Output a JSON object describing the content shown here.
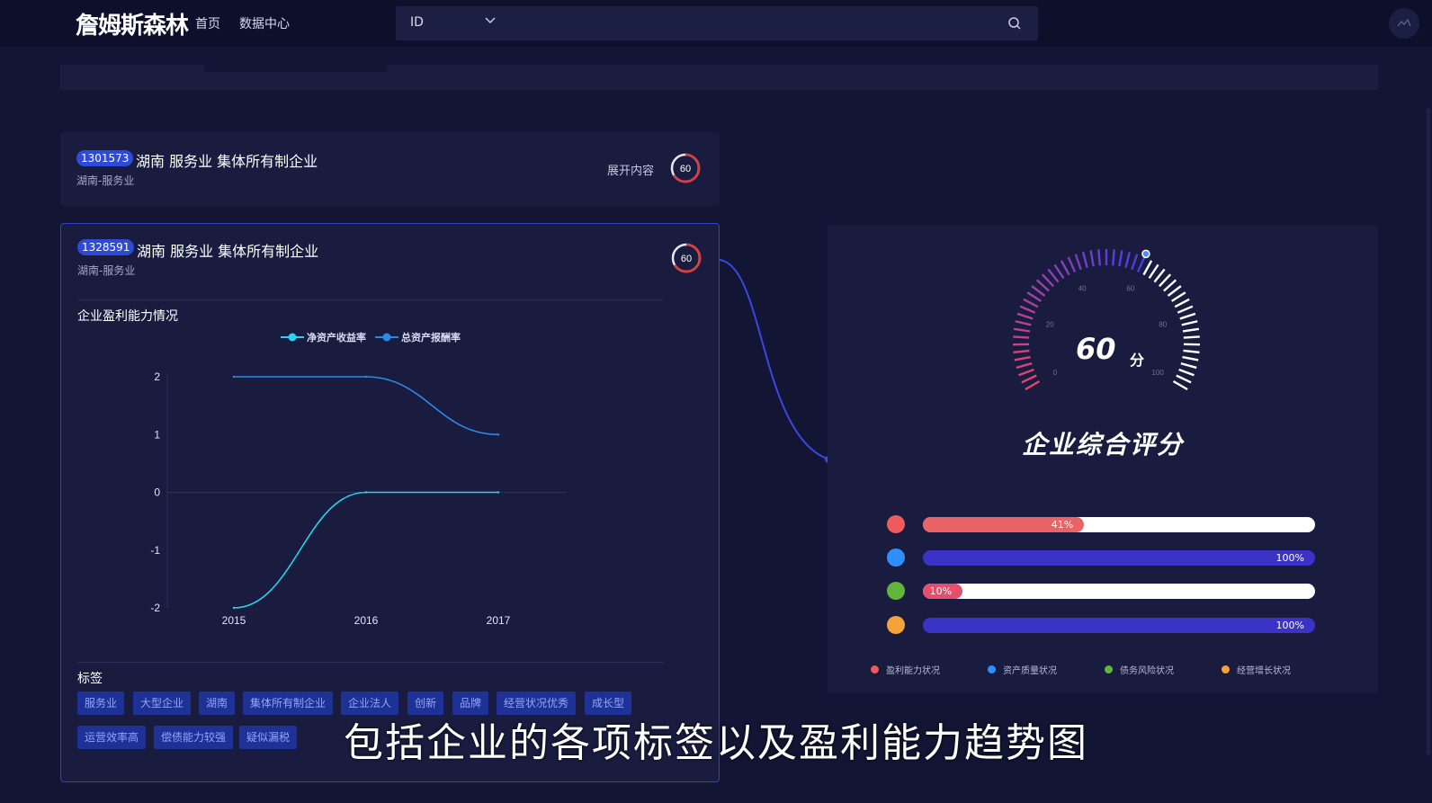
{
  "header": {
    "logo": "詹姆斯森林",
    "nav": [
      "首页",
      "数据中心"
    ],
    "search_select": "ID",
    "search_placeholder": ""
  },
  "cards": [
    {
      "id": "1301573",
      "title": "湖南 服务业 集体所有制企业",
      "subtitle": "湖南-服务业",
      "expand_label": "展开内容",
      "score": "60"
    },
    {
      "id": "1328591",
      "title": "湖南 服务业 集体所有制企业",
      "subtitle": "湖南-服务业",
      "score": "60",
      "chart_section_title": "企业盈利能力情况",
      "tags_title": "标签",
      "tags": [
        "服务业",
        "大型企业",
        "湖南",
        "集体所有制企业",
        "企业法人",
        "创新",
        "品牌",
        "经营状况优秀",
        "成长型",
        "运营效率高",
        "偿债能力较强",
        "疑似漏税"
      ]
    }
  ],
  "chart_data": {
    "type": "line",
    "title": "",
    "xlabel": "",
    "ylabel": "",
    "x": [
      "2015",
      "2016",
      "2017"
    ],
    "ylim": [
      -2,
      2
    ],
    "yticks": [
      "2",
      "1",
      "0",
      "-1",
      "-2"
    ],
    "smooth": true,
    "grid": false,
    "legend_position": "top-center",
    "series": [
      {
        "name": "净资产收益率",
        "values": [
          -2,
          0,
          0
        ],
        "color": "#2ad2ee"
      },
      {
        "name": "总资产报酬率",
        "values": [
          2,
          2,
          1
        ],
        "color": "#2b8ae8"
      }
    ]
  },
  "score_panel": {
    "score": "60",
    "unit": "分",
    "gauge_value": 60,
    "gauge_max": 100,
    "gauge_ticks": [
      "0",
      "20",
      "40",
      "60",
      "80",
      "100"
    ],
    "title": "企业综合评分",
    "bars": [
      {
        "name": "盈利能力状况",
        "value": 41,
        "label": "41%",
        "color": "#e86467",
        "track": "#ffffff"
      },
      {
        "name": "资产质量状况",
        "value": 100,
        "label": "100%",
        "color": "#3a33c6",
        "track": "#3a33c6"
      },
      {
        "name": "债务风险状况",
        "value": 10,
        "label": "10%",
        "color": "#e4506b",
        "track": "#ffffff"
      },
      {
        "name": "经营增长状况",
        "value": 100,
        "label": "100%",
        "color": "#3a33c6",
        "track": "#3a33c6"
      }
    ],
    "legend_colors": [
      "#f05a5a",
      "#2f8fff",
      "#62b53a",
      "#f5a23a"
    ]
  },
  "caption": "包括企业的各项标签以及盈利能力趋势图"
}
